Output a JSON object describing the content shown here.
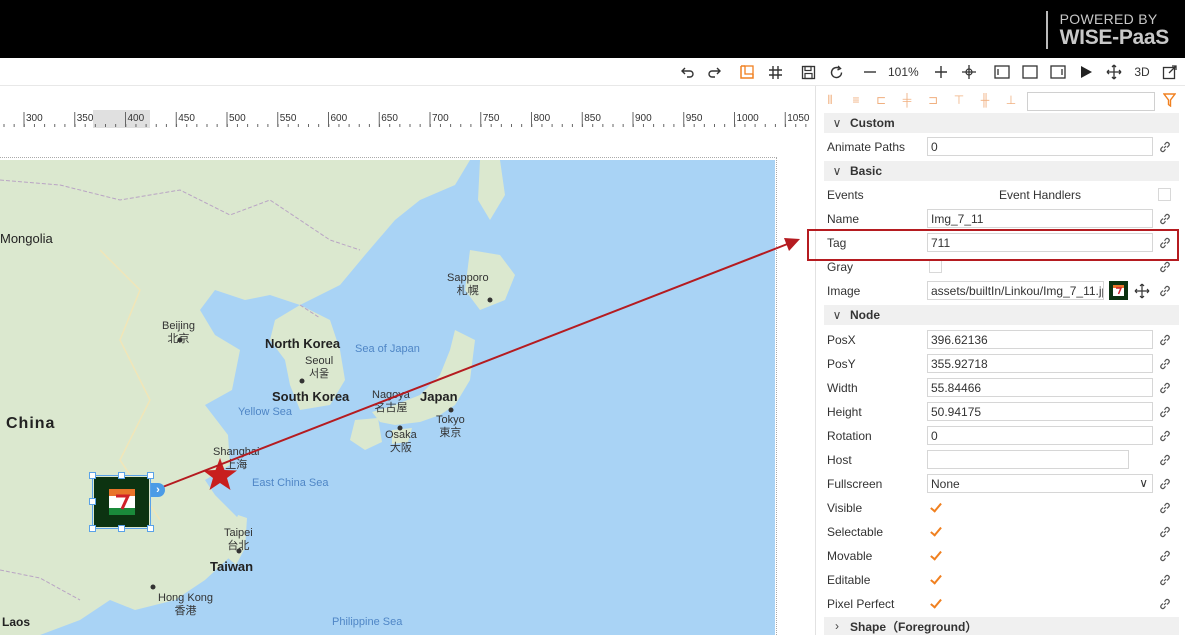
{
  "banner": {
    "brand_top": "POWERED BY",
    "brand_bottom": "WISE-PaaS"
  },
  "toolbar": {
    "zoom": "101%",
    "view_3d": "3D",
    "icons": [
      "undo-icon",
      "redo-icon",
      "snap-icon",
      "grid-icon",
      "save-icon",
      "reload-icon",
      "zoom-out-icon",
      "zoom-in-icon",
      "fit-icon",
      "rect-view-icon",
      "frame-icon",
      "panel-icon",
      "play-icon",
      "move-icon",
      "3d-label",
      "fullscreen-icon"
    ]
  },
  "ruler": {
    "ticks": [
      "300",
      "350",
      "400",
      "450",
      "500",
      "550",
      "600",
      "650",
      "700",
      "750",
      "800",
      "850",
      "900",
      "950",
      "1000",
      "1050"
    ]
  },
  "map": {
    "labels": {
      "mongolia": "Mongolia",
      "china": "China",
      "beijing_en": "Beijing",
      "beijing_zh": "北京",
      "north_korea": "North Korea",
      "seoul_en": "Seoul",
      "seoul_ko": "서울",
      "south_korea": "South Korea",
      "sea_of_japan": "Sea of Japan",
      "yellow_sea": "Yellow Sea",
      "sapporo_en": "Sapporo",
      "sapporo_zh": "札幌",
      "nagoya_en": "Nagoya",
      "nagoya_zh": "名古屋",
      "japan": "Japan",
      "tokyo_en": "Tokyo",
      "tokyo_zh": "東京",
      "osaka_en": "Osaka",
      "osaka_zh": "大阪",
      "shanghai_en": "Shanghai",
      "shanghai_zh": "上海",
      "east_china_sea": "East China Sea",
      "taipei_en": "Taipei",
      "taipei_zh": "台北",
      "taiwan": "Taiwan",
      "hongkong_en": "Hong Kong",
      "hongkong_zh": "香港",
      "laos": "Laos",
      "philippine_sea": "Philippine Sea"
    },
    "colors": {
      "water": "#a9d3f5",
      "land": "#dbe8cf",
      "star": "#c81e1e",
      "arrow": "#b51b20",
      "node_bg": "#0c3311"
    }
  },
  "panel": {
    "sections": {
      "custom": "Custom",
      "basic": "Basic",
      "node": "Node",
      "shape": "Shape（Foreground）"
    },
    "custom": {
      "animate_paths_label": "Animate Paths",
      "animate_paths_value": "0"
    },
    "basic": {
      "events_label": "Events",
      "event_handlers": "Event Handlers",
      "name_label": "Name",
      "name_value": "Img_7_11",
      "tag_label": "Tag",
      "tag_value": "711",
      "gray_label": "Gray",
      "image_label": "Image",
      "image_value": "assets/builtIn/Linkou/Img_7_11.jp"
    },
    "node": {
      "posx_label": "PosX",
      "posx_value": "396.62136",
      "posy_label": "PosY",
      "posy_value": "355.92718",
      "width_label": "Width",
      "width_value": "55.84466",
      "height_label": "Height",
      "height_value": "50.94175",
      "rotation_label": "Rotation",
      "rotation_value": "0",
      "host_label": "Host",
      "host_value": "",
      "fullscreen_label": "Fullscreen",
      "fullscreen_value": "None",
      "visible_label": "Visible",
      "selectable_label": "Selectable",
      "movable_label": "Movable",
      "editable_label": "Editable",
      "pixel_perfect_label": "Pixel Perfect"
    },
    "accent_color": "#f08020"
  }
}
